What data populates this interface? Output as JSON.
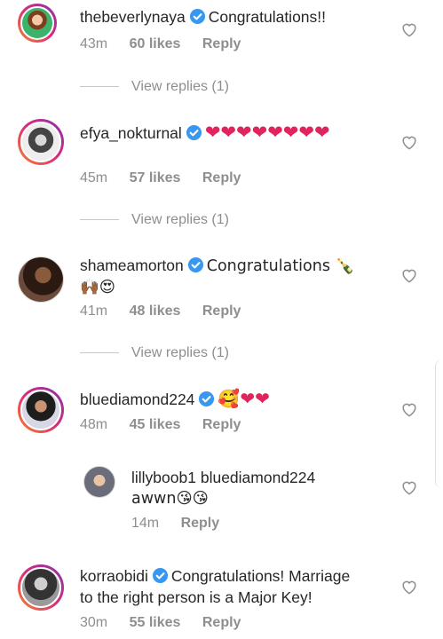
{
  "comments": [
    {
      "username": "thebeverlynaya",
      "text": "Congratulations!!",
      "time": "43m",
      "likes": "60 likes",
      "reply": "Reply",
      "view_replies": "View replies (1)"
    },
    {
      "username": "efya_nokturnal",
      "text": "❤❤❤❤❤❤❤❤",
      "time": "45m",
      "likes": "57 likes",
      "reply": "Reply",
      "view_replies": "View replies (1)"
    },
    {
      "username": "shameamorton",
      "text": "Congratulations 🍾",
      "text2": "🙌🏾😍",
      "time": "41m",
      "likes": "48 likes",
      "reply": "Reply",
      "view_replies": "View replies (1)"
    },
    {
      "username": "bluediamond224",
      "text": "🥰❤❤",
      "time": "48m",
      "likes": "45 likes",
      "reply": "Reply"
    },
    {
      "username": "lillyboob1",
      "text": "bluediamond224",
      "text2": "awwn😘😘",
      "time": "14m",
      "reply": "Reply"
    },
    {
      "username": "korraobidi",
      "text": "Congratulations! Marriage",
      "text2": "to the right person is a Major Key!",
      "time": "30m",
      "likes": "55 likes",
      "reply": "Reply"
    }
  ],
  "icons": {
    "verified": "verified-badge-icon",
    "like": "heart-outline-icon"
  },
  "colors": {
    "verified": "#3897f0",
    "meta": "#8e8e8e",
    "text": "#262626",
    "heart_emoji": "#e0245e"
  }
}
